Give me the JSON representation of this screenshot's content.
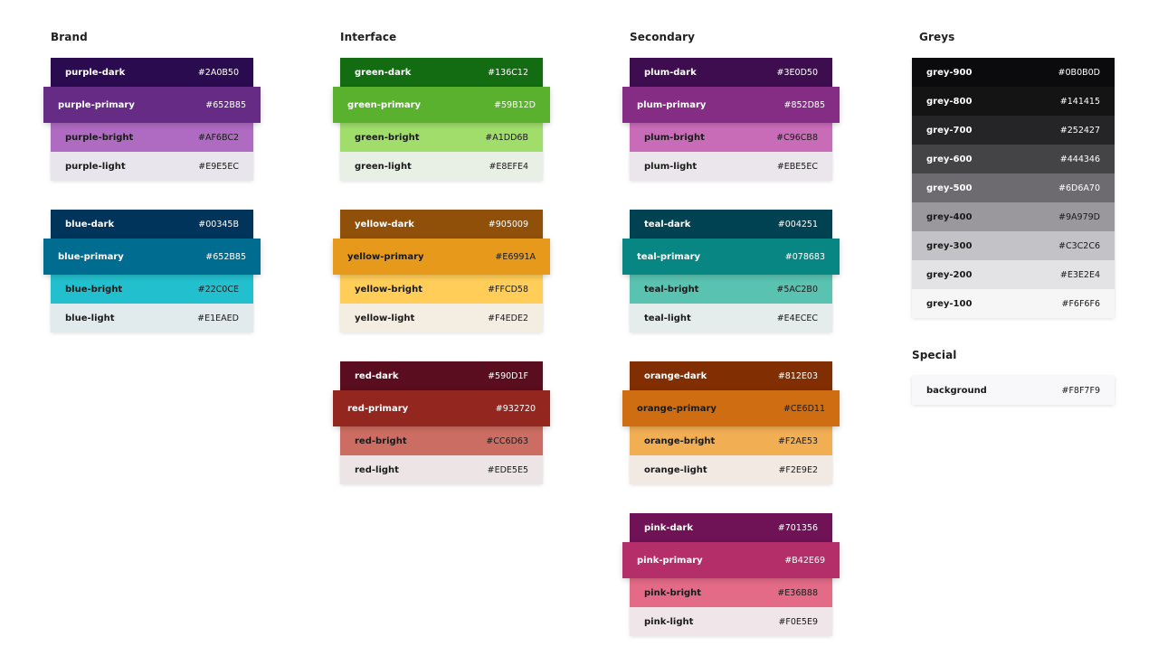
{
  "columns": [
    {
      "heading": "Brand",
      "groups": [
        {
          "swatches": [
            {
              "name": "purple-dark",
              "hex": "#2A0B50",
              "color": "#2A0B50",
              "text": "#ffffff"
            },
            {
              "name": "purple-primary",
              "hex": "#652B85",
              "color": "#652B85",
              "text": "#ffffff",
              "primary": true
            },
            {
              "name": "purple-bright",
              "hex": "#AF6BC2",
              "color": "#AF6BC2",
              "text": "#1a1a1a"
            },
            {
              "name": "purple-light",
              "hex": "#E9E5EC",
              "color": "#E9E5EC",
              "text": "#1a1a1a"
            }
          ]
        },
        {
          "swatches": [
            {
              "name": "blue-dark",
              "hex": "#00345B",
              "color": "#00345B",
              "text": "#ffffff"
            },
            {
              "name": "blue-primary",
              "hex": "#652B85",
              "color": "#006C8F",
              "text": "#ffffff",
              "primary": true
            },
            {
              "name": "blue-bright",
              "hex": "#22C0CE",
              "color": "#22C0CE",
              "text": "#1a1a1a"
            },
            {
              "name": "blue-light",
              "hex": "#E1EAED",
              "color": "#E1EAED",
              "text": "#1a1a1a"
            }
          ]
        }
      ]
    },
    {
      "heading": "Interface",
      "groups": [
        {
          "swatches": [
            {
              "name": "green-dark",
              "hex": "#136C12",
              "color": "#136C12",
              "text": "#ffffff"
            },
            {
              "name": "green-primary",
              "hex": "#59B12D",
              "color": "#59B12D",
              "text": "#ffffff",
              "primary": true
            },
            {
              "name": "green-bright",
              "hex": "#A1DD6B",
              "color": "#A1DD6B",
              "text": "#1a1a1a"
            },
            {
              "name": "green-light",
              "hex": "#E8EFE4",
              "color": "#E8EFE4",
              "text": "#1a1a1a"
            }
          ]
        },
        {
          "swatches": [
            {
              "name": "yellow-dark",
              "hex": "#905009",
              "color": "#905009",
              "text": "#ffffff"
            },
            {
              "name": "yellow-primary",
              "hex": "#E6991A",
              "color": "#E6991A",
              "text": "#1a1a1a",
              "primary": true
            },
            {
              "name": "yellow-bright",
              "hex": "#FFCD58",
              "color": "#FFCD58",
              "text": "#1a1a1a"
            },
            {
              "name": "yellow-light",
              "hex": "#F4EDE2",
              "color": "#F4EDE2",
              "text": "#1a1a1a"
            }
          ]
        },
        {
          "swatches": [
            {
              "name": "red-dark",
              "hex": "#590D1F",
              "color": "#590D1F",
              "text": "#ffffff"
            },
            {
              "name": "red-primary",
              "hex": "#932720",
              "color": "#932720",
              "text": "#ffffff",
              "primary": true
            },
            {
              "name": "red-bright",
              "hex": "#CC6D63",
              "color": "#CC6D63",
              "text": "#1a1a1a"
            },
            {
              "name": "red-light",
              "hex": "#EDE5E5",
              "color": "#EDE5E5",
              "text": "#1a1a1a"
            }
          ]
        }
      ]
    },
    {
      "heading": "Secondary",
      "groups": [
        {
          "swatches": [
            {
              "name": "plum-dark",
              "hex": "#3E0D50",
              "color": "#3E0D50",
              "text": "#ffffff"
            },
            {
              "name": "plum-primary",
              "hex": "#852D85",
              "color": "#852D85",
              "text": "#ffffff",
              "primary": true
            },
            {
              "name": "plum-bright",
              "hex": "#C96CB8",
              "color": "#C96CB8",
              "text": "#1a1a1a"
            },
            {
              "name": "plum-light",
              "hex": "#EBE5EC",
              "color": "#EBE5EC",
              "text": "#1a1a1a"
            }
          ]
        },
        {
          "swatches": [
            {
              "name": "teal-dark",
              "hex": "#004251",
              "color": "#004251",
              "text": "#ffffff"
            },
            {
              "name": "teal-primary",
              "hex": "#078683",
              "color": "#078683",
              "text": "#ffffff",
              "primary": true
            },
            {
              "name": "teal-bright",
              "hex": "#5AC2B0",
              "color": "#5AC2B0",
              "text": "#1a1a1a"
            },
            {
              "name": "teal-light",
              "hex": "#E4ECEC",
              "color": "#E4ECEC",
              "text": "#1a1a1a"
            }
          ]
        },
        {
          "swatches": [
            {
              "name": "orange-dark",
              "hex": "#812E03",
              "color": "#812E03",
              "text": "#ffffff"
            },
            {
              "name": "orange-primary",
              "hex": "#CE6D11",
              "color": "#CE6D11",
              "text": "#1a1a1a",
              "primary": true
            },
            {
              "name": "orange-bright",
              "hex": "#F2AE53",
              "color": "#F2AE53",
              "text": "#1a1a1a"
            },
            {
              "name": "orange-light",
              "hex": "#F2E9E2",
              "color": "#F2E9E2",
              "text": "#1a1a1a"
            }
          ]
        },
        {
          "swatches": [
            {
              "name": "pink-dark",
              "hex": "#701356",
              "color": "#701356",
              "text": "#ffffff"
            },
            {
              "name": "pink-primary",
              "hex": "#B42E69",
              "color": "#B42E69",
              "text": "#ffffff",
              "primary": true
            },
            {
              "name": "pink-bright",
              "hex": "#E36B88",
              "color": "#E36B88",
              "text": "#1a1a1a"
            },
            {
              "name": "pink-light",
              "hex": "#F0E5E9",
              "color": "#F0E5E9",
              "text": "#1a1a1a"
            }
          ]
        }
      ]
    }
  ],
  "greys": {
    "heading": "Greys",
    "swatches": [
      {
        "name": "grey-900",
        "hex": "#0B0B0D",
        "color": "#0B0B0D",
        "text": "#ffffff"
      },
      {
        "name": "grey-800",
        "hex": "#141415",
        "color": "#141415",
        "text": "#ffffff"
      },
      {
        "name": "grey-700",
        "hex": "#252427",
        "color": "#252427",
        "text": "#ffffff"
      },
      {
        "name": "grey-600",
        "hex": "#444346",
        "color": "#444346",
        "text": "#ffffff"
      },
      {
        "name": "grey-500",
        "hex": "#6D6A70",
        "color": "#6D6A70",
        "text": "#ffffff"
      },
      {
        "name": "grey-400",
        "hex": "#9A979D",
        "color": "#9A979D",
        "text": "#1a1a1a"
      },
      {
        "name": "grey-300",
        "hex": "#C3C2C6",
        "color": "#C3C2C6",
        "text": "#1a1a1a"
      },
      {
        "name": "grey-200",
        "hex": "#E3E2E4",
        "color": "#E3E2E4",
        "text": "#1a1a1a"
      },
      {
        "name": "grey-100",
        "hex": "#F6F6F6",
        "color": "#F6F6F6",
        "text": "#1a1a1a"
      }
    ]
  },
  "special": {
    "heading": "Special",
    "swatches": [
      {
        "name": "background",
        "hex": "#F8F7F9",
        "color": "#F8F7F9",
        "text": "#1a1a1a"
      }
    ]
  }
}
